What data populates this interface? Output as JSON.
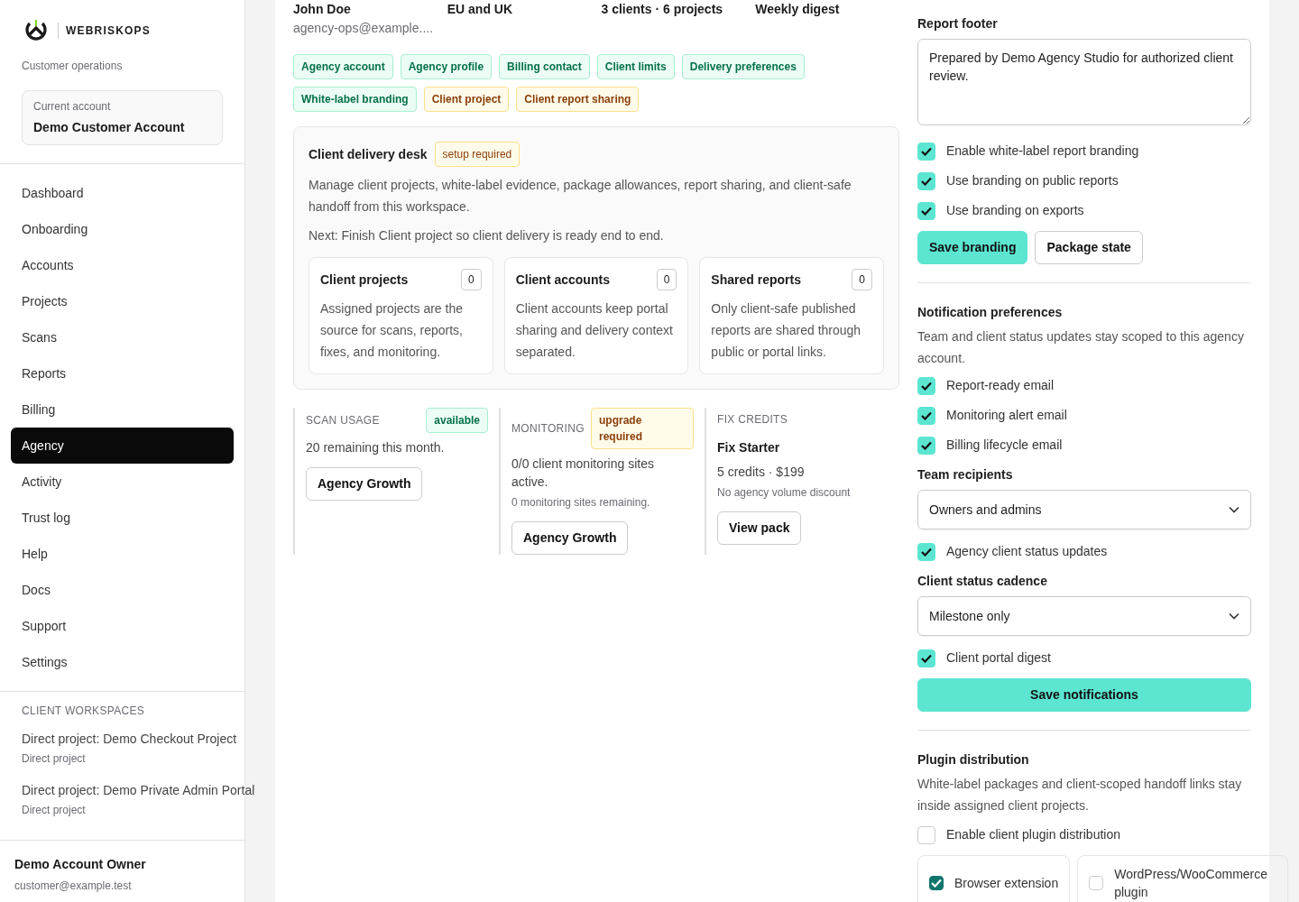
{
  "brand": {
    "name": "WEBRISKOPS",
    "subtitle": "Customer operations"
  },
  "current_account": {
    "label": "Current account",
    "value": "Demo Customer Account"
  },
  "nav": [
    {
      "label": "Dashboard",
      "selected": false
    },
    {
      "label": "Onboarding",
      "selected": false
    },
    {
      "label": "Accounts",
      "selected": false
    },
    {
      "label": "Projects",
      "selected": false
    },
    {
      "label": "Scans",
      "selected": false
    },
    {
      "label": "Reports",
      "selected": false
    },
    {
      "label": "Billing",
      "selected": false
    },
    {
      "label": "Agency",
      "selected": true
    },
    {
      "label": "Activity",
      "selected": false
    },
    {
      "label": "Trust log",
      "selected": false
    },
    {
      "label": "Help",
      "selected": false
    },
    {
      "label": "Docs",
      "selected": false
    },
    {
      "label": "Support",
      "selected": false
    },
    {
      "label": "Settings",
      "selected": false
    }
  ],
  "workspaces": {
    "heading": "CLIENT WORKSPACES",
    "items": [
      {
        "title": "Direct project: Demo Checkout Project",
        "subtitle": "Direct project"
      },
      {
        "title": "Direct project: Demo Private Admin Portal",
        "subtitle": "Direct project"
      }
    ]
  },
  "user": {
    "name": "Demo Account Owner",
    "email": "customer@example.test"
  },
  "summary": [
    {
      "value": "John Doe",
      "detail": "agency-ops@example...."
    },
    {
      "value": "EU and UK"
    },
    {
      "value": "3 clients · 6 projects"
    },
    {
      "value": "Weekly digest"
    }
  ],
  "tags": [
    {
      "label": "Agency account",
      "kind": "complete"
    },
    {
      "label": "Agency profile",
      "kind": "complete"
    },
    {
      "label": "Billing contact",
      "kind": "complete"
    },
    {
      "label": "Client limits",
      "kind": "complete"
    },
    {
      "label": "Delivery preferences",
      "kind": "complete"
    },
    {
      "label": "White-label branding",
      "kind": "complete"
    },
    {
      "label": "Client project",
      "kind": "pending"
    },
    {
      "label": "Client report sharing",
      "kind": "pending"
    }
  ],
  "desk": {
    "title": "Client delivery desk",
    "badge": "setup required",
    "description": "Manage client projects, white-label evidence, package allowances, report sharing, and client-safe handoff from this workspace.",
    "next": "Next: Finish Client project so client delivery is ready end to end.",
    "cards": [
      {
        "title": "Client projects",
        "count": "0",
        "text": "Assigned projects are the source for scans, reports, fixes, and monitoring."
      },
      {
        "title": "Client accounts",
        "count": "0",
        "text": "Client accounts keep portal sharing and delivery context separated."
      },
      {
        "title": "Shared reports",
        "count": "0",
        "text": "Only client-safe published reports are shared through public or portal links."
      }
    ]
  },
  "usage": [
    {
      "heading": "SCAN USAGE",
      "badge": {
        "label": "available",
        "kind": "complete"
      },
      "text": "20 remaining this month.",
      "button": "Agency Growth"
    },
    {
      "heading": "MONITORING",
      "badge": {
        "label": "upgrade required",
        "kind": "pending"
      },
      "text": "0/0 client monitoring sites active.",
      "note": "0 monitoring sites remaining.",
      "button": "Agency Growth"
    },
    {
      "heading": "FIX CREDITS",
      "title": "Fix Starter",
      "text": "5 credits · $199",
      "note": "No agency volume discount",
      "button": "View pack"
    }
  ],
  "branding": {
    "footer_label": "Report footer",
    "footer_value": "Prepared by Demo Agency Studio for authorized client review.",
    "options": [
      {
        "label": "Enable white-label report branding",
        "checked": true
      },
      {
        "label": "Use branding on public reports",
        "checked": true
      },
      {
        "label": "Use branding on exports",
        "checked": true
      }
    ],
    "buttons": [
      {
        "label": "Save branding",
        "kind": "primary"
      },
      {
        "label": "Package state",
        "kind": "secondary"
      }
    ]
  },
  "notifications": {
    "title": "Notification preferences",
    "description": "Team and client status updates stay scoped to this agency account.",
    "items": [
      {
        "kind": "checkbox",
        "label": "Report-ready email",
        "checked": true
      },
      {
        "kind": "checkbox",
        "label": "Monitoring alert email",
        "checked": true
      },
      {
        "kind": "checkbox",
        "label": "Billing lifecycle email",
        "checked": true
      },
      {
        "kind": "select",
        "label": "Team recipients",
        "value": "Owners and admins"
      },
      {
        "kind": "checkbox",
        "label": "Agency client status updates",
        "checked": true
      },
      {
        "kind": "select",
        "label": "Client status cadence",
        "value": "Milestone only"
      },
      {
        "kind": "checkbox",
        "label": "Client portal digest",
        "checked": true
      }
    ],
    "save": "Save notifications"
  },
  "plugin": {
    "title": "Plugin distribution",
    "description": "White-label packages and client-scoped handoff links stay inside assigned client projects.",
    "enable": {
      "label": "Enable client plugin distribution",
      "checked": false
    },
    "options": [
      {
        "label": "Browser extension",
        "checked": true
      },
      {
        "label": "WordPress/WooCommerce plugin",
        "checked": false
      }
    ]
  }
}
